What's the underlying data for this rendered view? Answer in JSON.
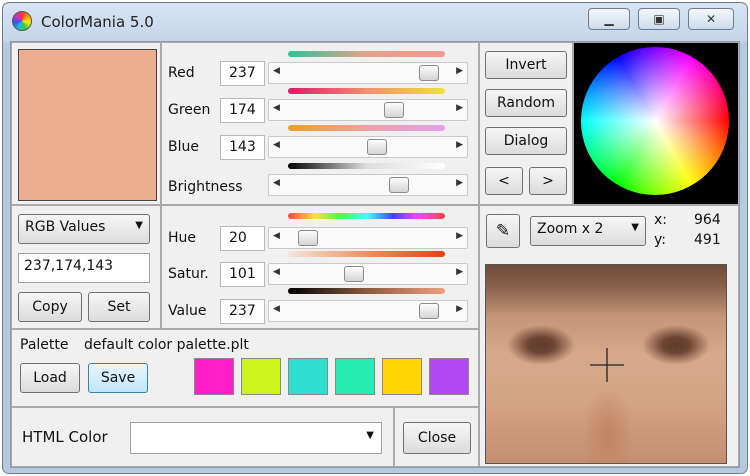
{
  "window": {
    "title": "ColorMania 5.0"
  },
  "window_buttons": {
    "minimize": "▁",
    "maximize": "▣",
    "close": "✕"
  },
  "color": {
    "swatch_hex": "#EDAE8F"
  },
  "rgb": [
    {
      "label": "Red",
      "value": "237",
      "fraction": 0.93
    },
    {
      "label": "Green",
      "value": "174",
      "fraction": 0.68
    },
    {
      "label": "Blue",
      "value": "143",
      "fraction": 0.56
    }
  ],
  "brightness": {
    "label": "Brightness",
    "fraction": 0.72
  },
  "buttons": {
    "invert": "Invert",
    "random": "Random",
    "dialog": "Dialog",
    "prev": "<",
    "next": ">"
  },
  "format": {
    "selected": "RGB Values",
    "value": "237,174,143",
    "copy": "Copy",
    "set": "Set"
  },
  "hsv": [
    {
      "label": "Hue",
      "value": "20",
      "fraction": 0.08
    },
    {
      "label": "Satur.",
      "value": "101",
      "fraction": 0.4
    },
    {
      "label": "Value",
      "value": "237",
      "fraction": 0.93
    }
  ],
  "zoom": {
    "selected": "Zoom x 2",
    "x_label": "x:",
    "x_value": "964",
    "y_label": "y:",
    "y_value": "491"
  },
  "palette": {
    "label": "Palette",
    "file": "default color palette.plt",
    "load": "Load",
    "save": "Save",
    "colors": [
      "#FF1DC4",
      "#CCF31B",
      "#2FE0D0",
      "#27ECB0",
      "#FFD600",
      "#B04AF0"
    ]
  },
  "html_color": {
    "label": "HTML Color",
    "value": "",
    "close": "Close"
  }
}
